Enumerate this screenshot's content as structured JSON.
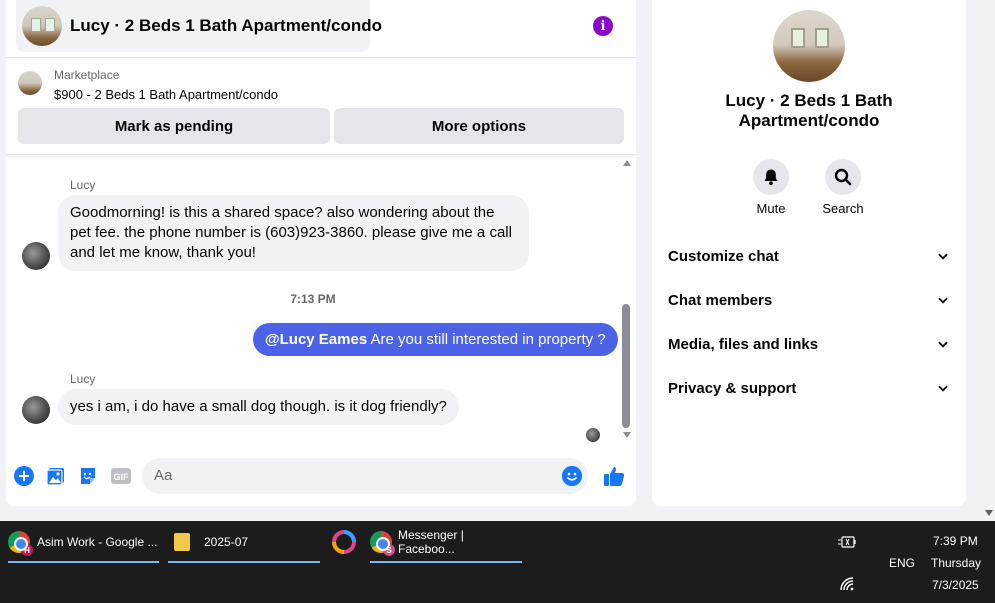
{
  "header": {
    "title": "Lucy · 2 Beds 1 Bath Apartment/condo",
    "info_icon": "i"
  },
  "marketplace": {
    "label": "Marketplace",
    "listing": "$900 - 2 Beds 1 Bath Apartment/condo",
    "buttons": {
      "pending": "Mark as pending",
      "more": "More options"
    }
  },
  "messages": {
    "msg1": {
      "sender": "Lucy",
      "text": "Goodmorning! is this a shared space? also wondering about the pet fee. the phone number is (603)923-3860. please give me a call and let me know, thank you!"
    },
    "time": "7:13 PM",
    "msg2": {
      "mention": "@Lucy Eames",
      "text": " Are you still interested in property ?"
    },
    "msg3": {
      "sender": "Lucy",
      "text": "yes i am, i do have a small dog though. is it dog friendly?"
    }
  },
  "composer": {
    "placeholder": "Aa",
    "gif_label": "GIF"
  },
  "info_panel": {
    "name": "Lucy · 2 Beds 1 Bath Apartment/condo",
    "actions": {
      "mute": "Mute",
      "search": "Search"
    },
    "rows": [
      "Customize chat",
      "Chat members",
      "Media, files and links",
      "Privacy & support"
    ]
  },
  "taskbar": {
    "tasks": [
      {
        "label": "Asim Work - Google ...",
        "badge": "H"
      },
      {
        "label": "2025-07"
      },
      {
        "label": "Messenger | Faceboo...",
        "badge": "S"
      }
    ],
    "tray": {
      "lang": "ENG",
      "time": "7:39 PM",
      "day": "Thursday",
      "date": "7/3/2025"
    }
  },
  "colors": {
    "accent": "#4c63e8",
    "fb_blue": "#1877f2",
    "info_purple": "#8a09c8"
  }
}
